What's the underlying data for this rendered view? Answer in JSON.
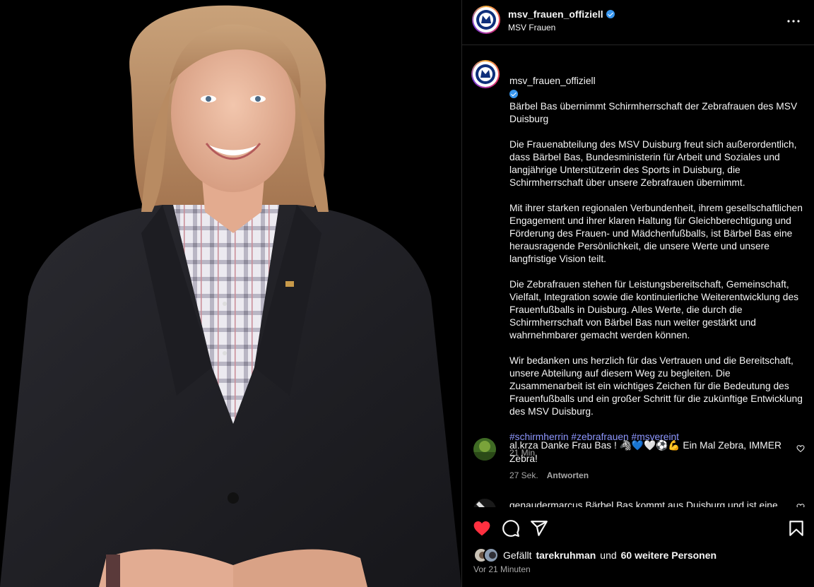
{
  "post": {
    "username": "msv_frauen_offiziell",
    "subtitle": "MSV Frauen"
  },
  "caption": {
    "username": "msv_frauen_offiziell",
    "title": "Bärbel Bas übernimmt Schirmherrschaft der Zebrafrauen des MSV Duisburg",
    "paragraphs": [
      "Die Frauenabteilung des MSV Duisburg freut sich außerordentlich, dass Bärbel Bas, Bundesministerin für Arbeit und Soziales und langjährige Unterstützerin des Sports in Duisburg, die Schirmherrschaft über unsere Zebrafrauen übernimmt.",
      "Mit ihrer starken regionalen Verbundenheit, ihrem gesellschaftlichen Engagement und ihrer klaren Haltung für Gleichberechtigung und Förderung des Frauen- und Mädchenfußballs, ist Bärbel Bas eine herausragende Persönlichkeit, die unsere Werte und unsere langfristige Vision teilt.",
      "Die Zebrafrauen stehen für Leistungsbereitschaft, Gemeinschaft, Vielfalt, Integration sowie die kontinuierliche Weiterentwicklung des Frauenfußballs in Duisburg. Alles Werte, die durch die Schirmherrschaft von Bärbel Bas nun weiter gestärkt und wahrnehmbarer gemacht werden können.",
      "Wir bedanken uns herzlich für das Vertrauen und die Bereitschaft, unsere Abteilung auf diesem Weg zu begleiten. Die Zusammenarbeit ist ein wichtiges Zeichen für die Bedeutung des Frauenfußballs und ein großer Schritt für die zukünftige Entwicklung des MSV Duisburg."
    ],
    "hashtags": "#schirmherrin #zebrafrauen #msvereint",
    "time": "21 Min."
  },
  "comments": [
    {
      "username": "al.krza",
      "text": "Danke Frau Bas ! 🦓💙🤍⚽💪 Ein Mal Zebra, IMMER Zebra!",
      "time": "27 Sek.",
      "reply": "Antworten"
    },
    {
      "username": "genaudermarcus",
      "text": "Bärbel Bas kommt aus Duisburg und ist eine",
      "time": "",
      "reply": ""
    }
  ],
  "likes": {
    "prefix": "Gefällt",
    "user": "tarekruhman",
    "and": "und",
    "others": "60 weitere Personen",
    "ago": "Vor 21 Minuten"
  },
  "icons": [
    "verified-badge-icon",
    "more-options-icon",
    "heart-icon",
    "comment-icon",
    "share-icon",
    "bookmark-icon"
  ],
  "colors": {
    "background": "#000000",
    "text": "#f5f5f5",
    "muted": "#a8a8a8",
    "hashtag": "#8e97ff",
    "like": "#ff3040",
    "verified": "#3897f0"
  }
}
